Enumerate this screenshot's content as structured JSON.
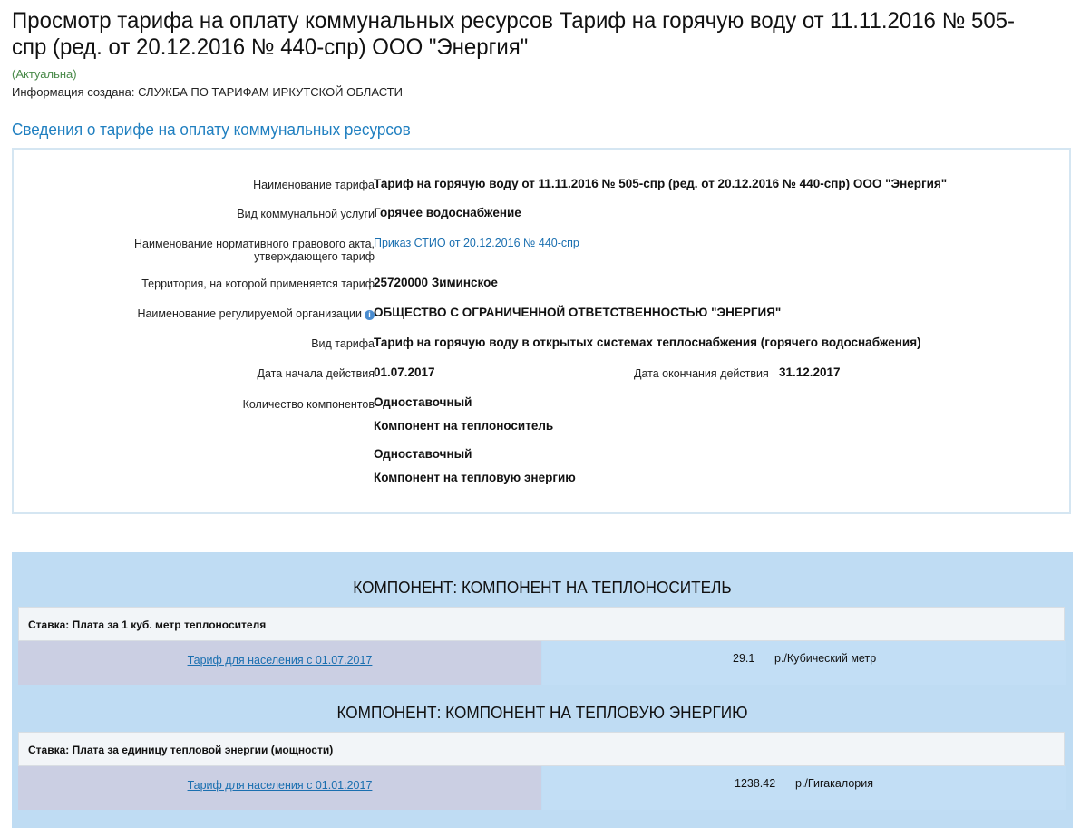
{
  "header": {
    "title": "Просмотр тарифа на оплату коммунальных ресурсов Тариф на горячую воду от 11.11.2016 № 505-спр (ред. от 20.12.2016 № 440-спр) ООО \"Энергия\"",
    "status": "(Актуальна)",
    "created_label": "Информация создана:",
    "created_by": "СЛУЖБА ПО ТАРИФАМ ИРКУТСКОЙ ОБЛАСТИ"
  },
  "details": {
    "section_title": "Сведения о тарифе на оплату коммунальных ресурсов",
    "tariff_name_label": "Наименование тарифа",
    "tariff_name": "Тариф на горячую воду от 11.11.2016 № 505-спр (ред. от 20.12.2016 № 440-спр) ООО \"Энергия\"",
    "service_label": "Вид коммунальной услуги",
    "service": "Горячее водоснабжение",
    "act_label": "Наименование нормативного правового акта, утверждающего тариф",
    "act_link": "Приказ СТИО от 20.12.2016 № 440-спр",
    "territory_label": "Территория, на которой применяется тариф",
    "territory": "25720000 Зиминское",
    "org_label": "Наименование регулируемой организации",
    "org": "ОБЩЕСТВО С ОГРАНИЧЕННОЙ ОТВЕТСТВЕННОСТЬЮ \"ЭНЕРГИЯ\"",
    "type_label": "Вид тарифа",
    "type": "Тариф на горячую воду в открытых системах теплоснабжения (горячего водоснабжения)",
    "start_label": "Дата начала действия",
    "start": "01.07.2017",
    "end_label": "Дата окончания действия",
    "end": "31.12.2017",
    "components_label": "Количество компонентов",
    "components": [
      {
        "kind": "Одноставочный",
        "name": "Компонент на теплоноситель"
      },
      {
        "kind": "Одноставочный",
        "name": "Компонент на тепловую энергию"
      }
    ]
  },
  "components": [
    {
      "heading": "КОМПОНЕНТ: КОМПОНЕНТ НА ТЕПЛОНОСИТЕЛЬ",
      "rate_prefix": "Ставка: Плата за ",
      "rate_bold": "1",
      "rate_suffix": " куб. метр теплоносителя",
      "tariff_link": "Тариф для населения с 01.07.2017",
      "amount": "29.1",
      "unit": "р./Кубический метр"
    },
    {
      "heading": "КОМПОНЕНТ: КОМПОНЕНТ НА ТЕПЛОВУЮ ЭНЕРГИЮ",
      "rate_prefix": "Ставка: Плата за единицу тепловой энергии (мощности)",
      "rate_bold": "",
      "rate_suffix": "",
      "tariff_link": "Тариф для населения с 01.01.2017",
      "amount": "1238.42",
      "unit": "р./Гигакалория"
    }
  ],
  "colors": {
    "accent": "#1f7fc0",
    "status": "#4a8a4a",
    "panel": "#bfdcf3"
  }
}
